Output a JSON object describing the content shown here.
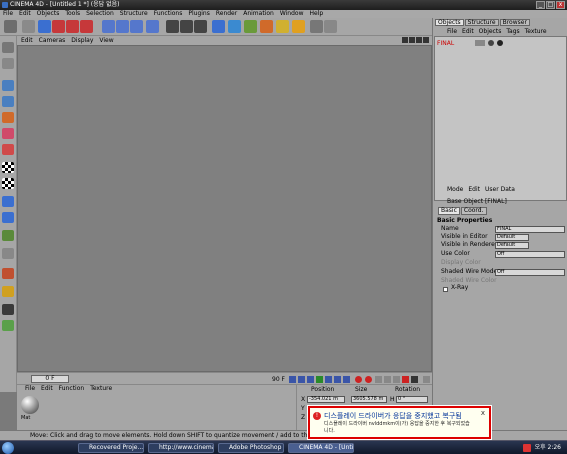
{
  "window": {
    "title": "CINEMA 4D - [Untitled 1 *] (응답 없음)",
    "controls": [
      "_",
      "□",
      "x"
    ]
  },
  "menubar": [
    "File",
    "Edit",
    "Objects",
    "Tools",
    "Selection",
    "Structure",
    "Functions",
    "Plugins",
    "Render",
    "Animation",
    "Window",
    "Help"
  ],
  "viewport": {
    "menu": [
      "Edit",
      "Cameras",
      "Display",
      "View"
    ]
  },
  "timeline": {
    "current_frame": "0 F",
    "end_frame": "90 F"
  },
  "material_manager": {
    "menu": [
      "File",
      "Edit",
      "Function",
      "Texture"
    ],
    "material_name": "Mat"
  },
  "coordinates": {
    "headers": [
      "Position",
      "Size",
      "Rotation"
    ],
    "x_position": "-354.021 m",
    "x_size": "3605.578 m",
    "rotation_label": "H",
    "h_rotation": "0 °",
    "row_labels": [
      "X",
      "Y",
      "Z"
    ]
  },
  "right_panel": {
    "tabs": [
      "Objects",
      "Structure",
      "Browser"
    ],
    "object_menu": [
      "File",
      "Edit",
      "Objects",
      "Tags",
      "Texture"
    ],
    "objects": [
      {
        "name": "FINAL"
      }
    ]
  },
  "attributes": {
    "menu": [
      "Mode",
      "Edit",
      "User Data"
    ],
    "subtitle": "Base Object [FINAL]",
    "tabs": [
      "Basic",
      "Coord."
    ],
    "section": "Basic Properties",
    "rows": [
      {
        "label": "Name",
        "value": "FINAL"
      },
      {
        "label": "Visible in Editor",
        "value": "Default"
      },
      {
        "label": "Visible in Renderer",
        "value": "Default"
      },
      {
        "label": "Use Color",
        "value": "Off"
      },
      {
        "label": "Display Color",
        "value": ""
      },
      {
        "label": "Shaded Wire Mode",
        "value": "Off"
      },
      {
        "label": "Shaded Wire Color",
        "value": ""
      },
      {
        "label": "X-Ray",
        "value": ""
      }
    ]
  },
  "notification": {
    "title": "디스플레이 드라이버가 응답을 중지했고 복구됨",
    "body": "디스플레이 드라이버 nvlddmkm이(가) 응답을 중지한 후 복구되었습니다.",
    "close": "x"
  },
  "status": {
    "text": "Move: Click and drag to move elements. Hold down SHIFT to quantize movement / add to the selection in point mode, CTRL to remove."
  },
  "taskbar": {
    "tasks": [
      "Recovered Proje...",
      "http://www.cinema...",
      "Adobe Photoshop",
      "CINEMA 4D - [Unti..."
    ],
    "clock": "오후 2:26"
  }
}
